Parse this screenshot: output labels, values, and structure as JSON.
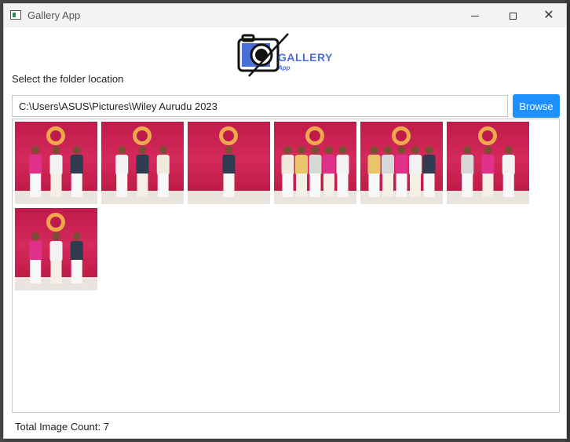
{
  "window": {
    "title": "Gallery App"
  },
  "logo": {
    "text": "GALLERY",
    "subtext": "App"
  },
  "folder": {
    "label": "Select the folder location",
    "path_value": "C:\\Users\\ASUS\\Pictures\\Wiley Aurudu 2023",
    "browse_label": "Browse"
  },
  "gallery": {
    "thumbnails": [
      {
        "people": 3
      },
      {
        "people": 3
      },
      {
        "people": 1
      },
      {
        "people": 5
      },
      {
        "people": 5
      },
      {
        "people": 3
      },
      {
        "people": 3
      }
    ]
  },
  "footer": {
    "count_text": "Total Image Count: 7"
  },
  "colors": {
    "accent": "#1e90ff",
    "logo_blue": "#4a6fd8",
    "thumb_bg": "#c01a4a"
  }
}
